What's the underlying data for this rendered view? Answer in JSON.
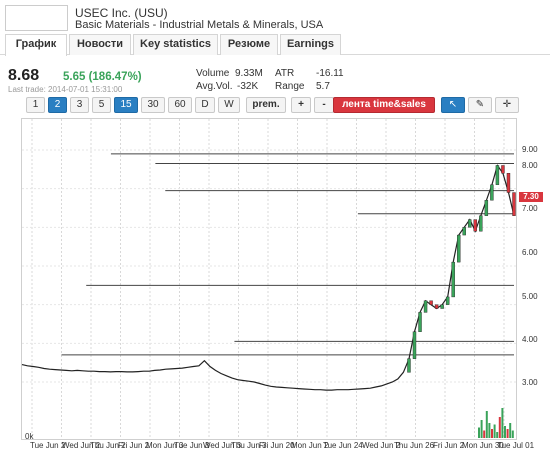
{
  "header": {
    "company": "USEC Inc. (USU)",
    "sector": "Basic Materials - Industrial Metals & Minerals, USA"
  },
  "tabs": [
    "График",
    "Новости",
    "Key statistics",
    "Резюме",
    "Earnings"
  ],
  "quote": {
    "price": "8.68",
    "change": "5.65 (186.47%)",
    "last_trade": "Last trade: 2014-07-01 15:31:00",
    "volume_label": "Volume",
    "volume": "9.33M",
    "atr_label": "ATR",
    "atr": "-16.11",
    "avgvol_label": "Avg.Vol.",
    "avgvol": "-32K",
    "range_label": "Range",
    "range": "5.7"
  },
  "toolbar": {
    "periods": [
      "1",
      "2",
      "3",
      "5",
      "15",
      "30",
      "60",
      "D",
      "W"
    ],
    "prem": "prem.",
    "plus": "+",
    "minus": "-",
    "tape": "лента time&sales",
    "cursor": "↖",
    "draw": "✎",
    "crosshair": "✛"
  },
  "colors": {
    "accent": "#2a7fc2",
    "up": "#3aa35a",
    "down": "#d9363e"
  },
  "chart_data": {
    "type": "line",
    "current_price_label": "7.30",
    "y_ticks": [
      "9.00",
      "8.00",
      "7.00",
      "6.00",
      "5.00",
      "4.00",
      "3.00"
    ],
    "y_values": [
      9,
      8,
      7,
      6,
      5,
      4,
      3
    ],
    "x_ticks": [
      "Tue Jun 2",
      "Wed Jun 2",
      "Thu Jun 2",
      "Fri Jun 2",
      "Mon Jun 3",
      "Tue Jun 3",
      "Wed Jun 3",
      "Thu Jun 3",
      "Fri Jun 20",
      "Mon Jun 2",
      "Tue Jun 24",
      "Wed Jun 2",
      "Thu Jun 26",
      "Fri Jun 2",
      "Mon Jun 30",
      "Tue Jul 01"
    ],
    "volume_zero_label": "0k",
    "ylim": [
      2.5,
      9.3
    ],
    "price_series": [
      3.45,
      3.42,
      3.4,
      3.38,
      3.35,
      3.33,
      3.32,
      3.31,
      3.3,
      3.29,
      3.3,
      3.29,
      3.28,
      3.28,
      3.27,
      3.27,
      3.26,
      3.27,
      3.27,
      3.26,
      3.26,
      3.27,
      3.28,
      3.28,
      3.3,
      3.31,
      3.33,
      3.34,
      3.35,
      3.36,
      3.38,
      3.4,
      3.42,
      3.55,
      3.4,
      3.3,
      3.22,
      3.16,
      3.1,
      3.06,
      3.04,
      3.02,
      3.0,
      2.96,
      2.92,
      2.89,
      2.87,
      2.86,
      2.85,
      2.84,
      2.83,
      2.82,
      2.81,
      2.8,
      2.8,
      2.79,
      2.79,
      2.8,
      2.8,
      2.8,
      2.81,
      2.82,
      2.83,
      2.84,
      2.87,
      2.9,
      2.95,
      3.0,
      3.08,
      3.25,
      3.6,
      4.3,
      4.8,
      5.1,
      5.0,
      4.9,
      5.0,
      5.2,
      6.1,
      6.8,
      7.0,
      7.2,
      6.9,
      7.3,
      7.7,
      8.1,
      8.6,
      8.4,
      7.9,
      7.3
    ],
    "h_lines": [
      {
        "price": 8.9,
        "from": 0.18
      },
      {
        "price": 8.65,
        "from": 0.27
      },
      {
        "price": 7.95,
        "from": 0.29
      },
      {
        "price": 7.35,
        "from": 0.68
      },
      {
        "price": 5.5,
        "from": 0.13
      },
      {
        "price": 4.05,
        "from": 0.43
      },
      {
        "price": 3.7,
        "from": 0.08
      }
    ],
    "volume_series": [
      0,
      0,
      0,
      0,
      0,
      0,
      0,
      0,
      0,
      0,
      0,
      0,
      0,
      0,
      0,
      0,
      0,
      0,
      0,
      0,
      0,
      0,
      0,
      0,
      0,
      0,
      0,
      0,
      0,
      0,
      0,
      0,
      0,
      0,
      0,
      0,
      0,
      0,
      0,
      0,
      0,
      0,
      0,
      0,
      0,
      0,
      0,
      0,
      0,
      0,
      0,
      0,
      0,
      0,
      0,
      0,
      0,
      0,
      0,
      0,
      0,
      0,
      0,
      0,
      0,
      0,
      0,
      0,
      0,
      0,
      0.35,
      0.6,
      0.25,
      0.9,
      0.5,
      0.3,
      0.45,
      0.2,
      0.7,
      1.0,
      0.4,
      0.3,
      0.5,
      0.25
    ]
  }
}
